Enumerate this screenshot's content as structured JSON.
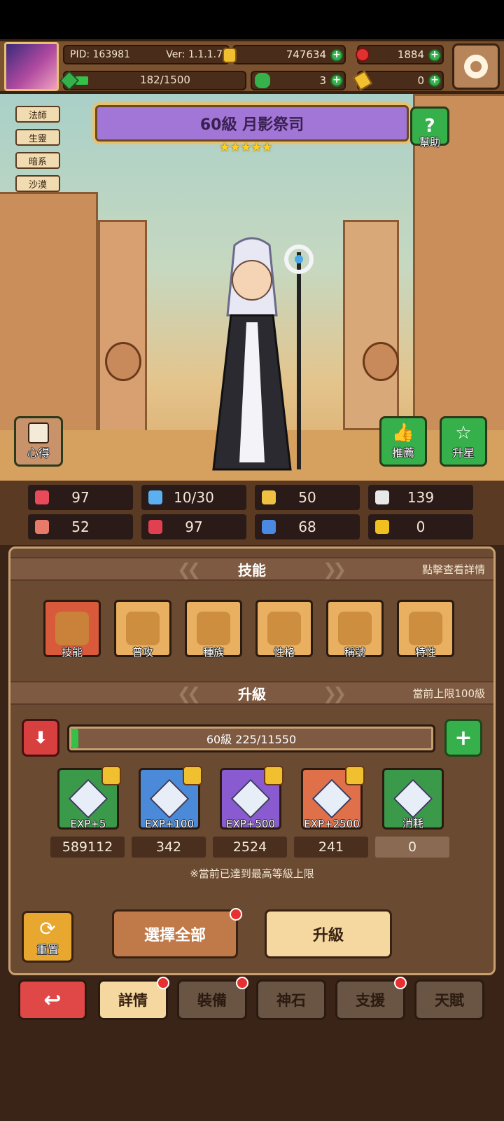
{
  "top": {
    "pid": "PID: 163981",
    "version": "Ver: 1.1.1.7",
    "xp": "182/1500",
    "xp_fraction": 0.121,
    "gold": "747634",
    "gems": "1884",
    "clover": "3",
    "ticket": "0"
  },
  "tags": [
    "法師",
    "生靈",
    "暗系",
    "沙漠"
  ],
  "hero": {
    "title": "60級  月影祭司",
    "stars": "★★★★★",
    "help": "幫助",
    "tips": "心得",
    "recommend": "推薦",
    "star_up": "升星"
  },
  "stats": [
    {
      "value": "97",
      "icon": "heart-icon",
      "color": "#e84a5a"
    },
    {
      "value": "10/30",
      "icon": "mana-drop-icon",
      "color": "#5ab0f0"
    },
    {
      "value": "50",
      "icon": "shield-icon",
      "color": "#f0c040"
    },
    {
      "value": "139",
      "icon": "wing-icon",
      "color": "#e8e8e8"
    },
    {
      "value": "52",
      "icon": "fist-icon",
      "color": "#e87a6a"
    },
    {
      "value": "97",
      "icon": "book-icon",
      "color": "#e04050"
    },
    {
      "value": "68",
      "icon": "boot-icon",
      "color": "#4a8ae0"
    },
    {
      "value": "0",
      "icon": "horseshoe-icon",
      "color": "#f0c020"
    }
  ],
  "skills_section": {
    "title": "技能",
    "hint": "點擊查看詳情"
  },
  "skills": [
    {
      "label": "技能",
      "color": "#d85a3a"
    },
    {
      "label": "普攻",
      "color": "#e8b060"
    },
    {
      "label": "種族",
      "color": "#e8b060"
    },
    {
      "label": "性格",
      "color": "#e8b060"
    },
    {
      "label": "稱號",
      "color": "#e8b060"
    },
    {
      "label": "特性",
      "color": "#e8b060"
    }
  ],
  "level_section": {
    "title": "升級",
    "hint": "當前上限100級"
  },
  "level_bar": {
    "text": "60級  225/11550",
    "fraction": 0.019
  },
  "items": [
    {
      "label": "EXP+5",
      "count": "589112",
      "color": "#3a9a4a"
    },
    {
      "label": "EXP+100",
      "count": "342",
      "color": "#4a8ad8"
    },
    {
      "label": "EXP+500",
      "count": "2524",
      "color": "#8a5ad0"
    },
    {
      "label": "EXP+2500",
      "count": "241",
      "color": "#e0704a"
    },
    {
      "label": "消耗",
      "count": "0",
      "color": "#3a9a4a"
    }
  ],
  "note": "※當前已達到最高等級上限",
  "actions": {
    "reset": "重置",
    "select_all": "選擇全部",
    "upgrade": "升級"
  },
  "tabs": [
    "詳情",
    "裝備",
    "神石",
    "支援",
    "天賦"
  ]
}
